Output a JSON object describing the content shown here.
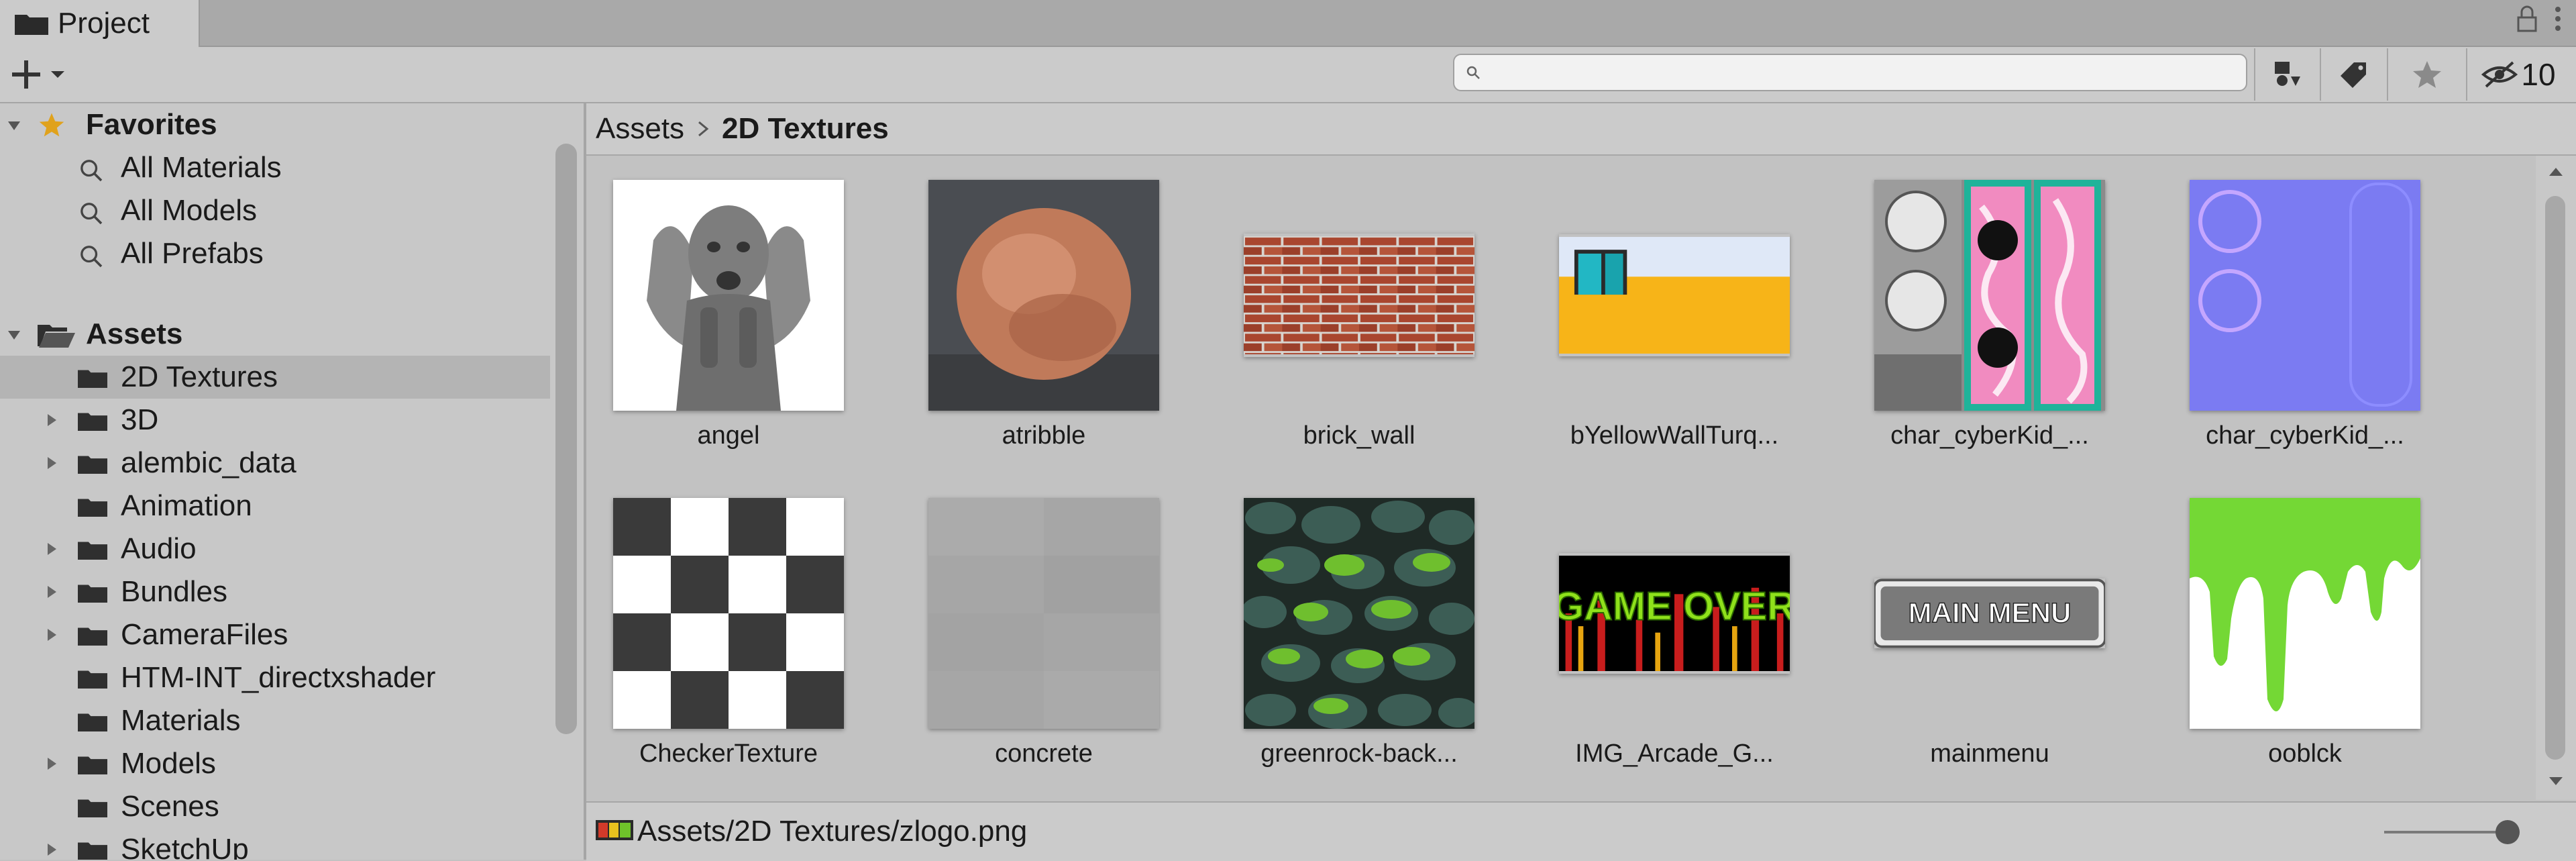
{
  "tab": {
    "title": "Project"
  },
  "toolbar": {
    "search_placeholder": "",
    "hidden_count": "10"
  },
  "tree": {
    "favorites_label": "Favorites",
    "favorites": [
      "All Materials",
      "All Models",
      "All Prefabs"
    ],
    "assets_label": "Assets",
    "folders": [
      {
        "name": "2D Textures",
        "expandable": false,
        "selected": true
      },
      {
        "name": "3D",
        "expandable": true
      },
      {
        "name": "alembic_data",
        "expandable": true
      },
      {
        "name": "Animation",
        "expandable": false
      },
      {
        "name": "Audio",
        "expandable": true
      },
      {
        "name": "Bundles",
        "expandable": true
      },
      {
        "name": "CameraFiles",
        "expandable": true
      },
      {
        "name": "HTM-INT_directxshader",
        "expandable": false
      },
      {
        "name": "Materials",
        "expandable": false
      },
      {
        "name": "Models",
        "expandable": true
      },
      {
        "name": "Scenes",
        "expandable": false
      },
      {
        "name": "SketchUp",
        "expandable": true
      }
    ]
  },
  "breadcrumb": {
    "root": "Assets",
    "current": "2D Textures"
  },
  "assets": [
    {
      "name": "angel"
    },
    {
      "name": "atribble"
    },
    {
      "name": "brick_wall"
    },
    {
      "name": "bYellowWallTurq..."
    },
    {
      "name": "char_cyberKid_..."
    },
    {
      "name": "char_cyberKid_..."
    },
    {
      "name": "CheckerTexture"
    },
    {
      "name": "concrete"
    },
    {
      "name": "greenrock-back..."
    },
    {
      "name": "IMG_Arcade_G...",
      "thumb_text": "GAME OVER"
    },
    {
      "name": "mainmenu",
      "thumb_text": "MAIN MENU"
    },
    {
      "name": "ooblck"
    }
  ],
  "status": {
    "path": "Assets/2D Textures/zlogo.png"
  },
  "colors": {
    "accent_star": "#e0a21c",
    "selected_row": "#b4b4b4",
    "panel_bg": "#c8c8c8"
  }
}
